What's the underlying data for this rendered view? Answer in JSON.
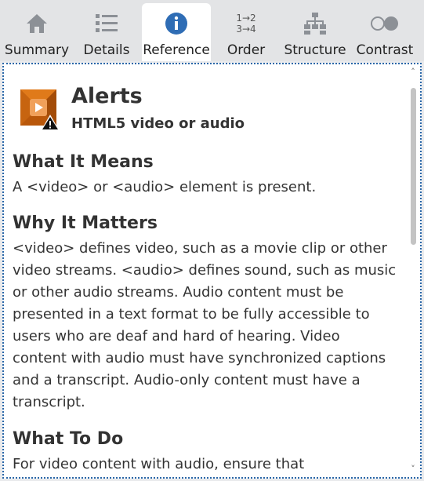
{
  "tabs": [
    {
      "label": "Summary",
      "icon": "home-icon",
      "active": false
    },
    {
      "label": "Details",
      "icon": "list-icon",
      "active": false
    },
    {
      "label": "Reference",
      "icon": "info-icon",
      "active": true
    },
    {
      "label": "Order",
      "icon": "order-icon",
      "active": false
    },
    {
      "label": "Structure",
      "icon": "structure-icon",
      "active": false
    },
    {
      "label": "Contrast",
      "icon": "contrast-icon",
      "active": false
    }
  ],
  "order_icon_text": {
    "line1": "1→2",
    "line2": "3→4"
  },
  "alert": {
    "title": "Alerts",
    "subtitle": "HTML5 video or audio",
    "icon": "video-alert-icon"
  },
  "sections": [
    {
      "heading": "What It Means",
      "body": "A <video> or <audio> element is present."
    },
    {
      "heading": "Why It Matters",
      "body": "<video> defines video, such as a movie clip or other video streams. <audio> defines sound, such as music or other audio streams. Audio content must be presented in a text format to be fully accessible to users who are deaf and hard of hearing. Video content with audio must have synchronized captions and a transcript. Audio-only content must have a transcript."
    },
    {
      "heading": "What To Do",
      "body": "For video content with audio, ensure that"
    }
  ],
  "colors": {
    "accent": "#2a67a8",
    "icon_gray": "#8c9096",
    "info_blue": "#2f6db5",
    "video_orange": "#d86f12"
  }
}
